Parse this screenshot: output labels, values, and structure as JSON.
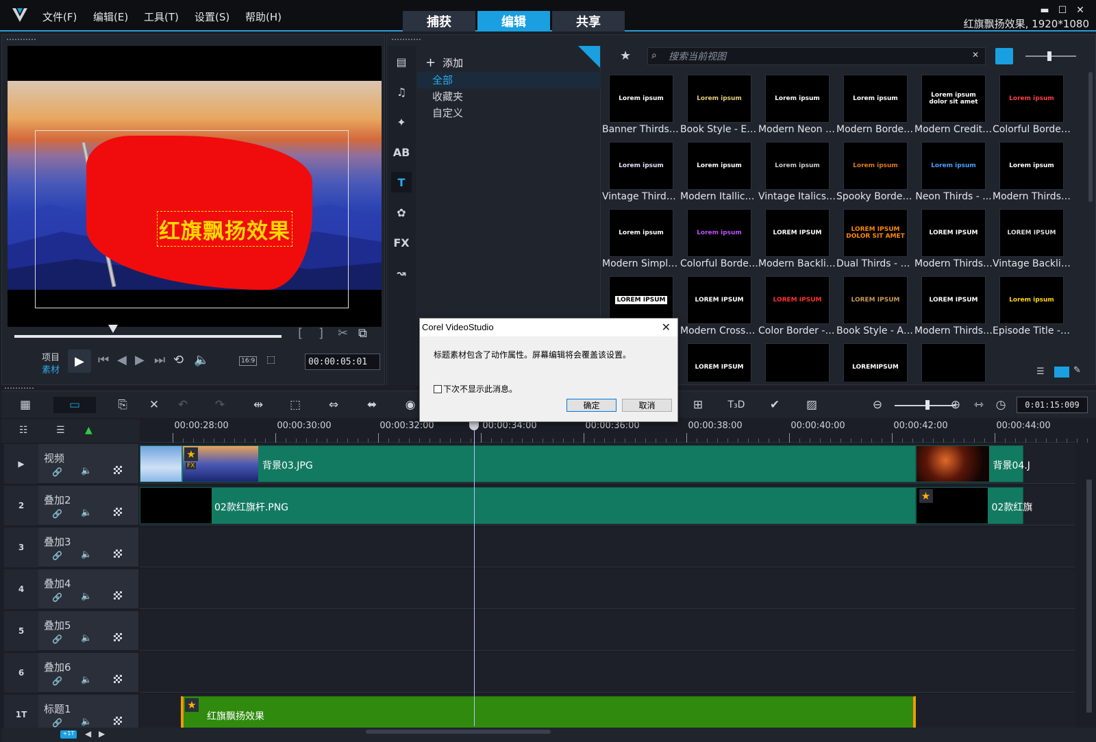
{
  "titlebar": {
    "menus": [
      "文件(F)",
      "编辑(E)",
      "工具(T)",
      "设置(S)",
      "帮助(H)"
    ],
    "mode_tabs": [
      "捕获",
      "编辑",
      "共享"
    ],
    "active_tab": "编辑",
    "project_title": "红旗飘扬效果, 1920*1080",
    "window_buttons": [
      "minimize-icon",
      "maximize-icon",
      "close-icon"
    ]
  },
  "player": {
    "overlay_text": "红旗飘扬效果",
    "mode_project": "项目",
    "mode_clip": "素材",
    "aspect": "16:9",
    "timecode": "00:00:05:01",
    "scrub_progress": 0.37
  },
  "library": {
    "add_label": "添加",
    "folders": [
      "全部",
      "收藏夹",
      "自定义"
    ],
    "active_folder": "全部",
    "search_placeholder": "搜索当前视图",
    "sidebar_icons": [
      "media-icon",
      "music-icon",
      "instant-project-icon",
      "transition-icon",
      "title-icon",
      "graphics-icon",
      "filter-icon",
      "path-icon"
    ],
    "sidebar_labels": {
      "transition": "AB",
      "title": "T",
      "filter": "FX"
    },
    "tiles": [
      {
        "label": "Banner Thirds - ...",
        "preview": "Lorem ipsum",
        "color": "#ffffff"
      },
      {
        "label": "Book Style - Ex...",
        "preview": "Lorem ipsum",
        "color": "#e8d07a"
      },
      {
        "label": "Modern Neon -...",
        "preview": "Lorem ipsum",
        "color": "#ffffff"
      },
      {
        "label": "Modern Border...",
        "preview": "Lorem ipsum",
        "color": "#ffffff"
      },
      {
        "label": "Modern Credits...",
        "preview": "Lorem ipsum dolor sit amet",
        "color": "#ffffff"
      },
      {
        "label": "Colorful Border...",
        "preview": "Lorem ipsum",
        "color": "#ff4040"
      },
      {
        "label": "Vintage Thirds ...",
        "preview": "Lorem ipsum",
        "color": "#e8e0ff"
      },
      {
        "label": "Modern Itallics ...",
        "preview": "Lorem ipsum",
        "color": "#ffffff"
      },
      {
        "label": "Vintage Italics -...",
        "preview": "Lorem ipsum",
        "color": "#cccccc"
      },
      {
        "label": "Spooky Border ...",
        "preview": "Lorem ipsum",
        "color": "#e07a1a"
      },
      {
        "label": "Neon Thirds - ...",
        "preview": "Lorem ipsum",
        "color": "#4aa0ff"
      },
      {
        "label": "Modern Thirds ...",
        "preview": "Lorem ipsum",
        "color": "#ffffff"
      },
      {
        "label": "Modern Simple...",
        "preview": "Lorem ipsum",
        "color": "#ffffff"
      },
      {
        "label": "Colorful Border...",
        "preview": "Lorem ipsum",
        "color": "#c050ff"
      },
      {
        "label": "Modern Backlig...",
        "preview": "LOREM IPSUM",
        "color": "#ffffff"
      },
      {
        "label": "Dual Thirds - R...",
        "preview": "LOREM IPSUM DOLOR SIT AMET",
        "color": "#ff8a00"
      },
      {
        "label": "Modern Thirds ...",
        "preview": "LOREM IPSUM",
        "color": "#ffffff"
      },
      {
        "label": "Vintage Backlig...",
        "preview": "LOREM IPSUM",
        "color": "#dddddd"
      },
      {
        "label": "",
        "preview": "LOREM IPSUM",
        "color": "#000000"
      },
      {
        "label": "Modern Crossw...",
        "preview": "LOREM IPSUM",
        "color": "#ffffff"
      },
      {
        "label": "Color Border - ...",
        "preview": "LOREM IPSUM",
        "color": "#ff3030"
      },
      {
        "label": "Book Style - Ap...",
        "preview": "LOREM IPSUM",
        "color": "#c89a5a"
      },
      {
        "label": "Modern Thirds ...",
        "preview": "LOREM IPSUM",
        "color": "#ffffff"
      },
      {
        "label": "Episode Title - ...",
        "preview": "Lorem ipsum",
        "color": "#ffd800"
      },
      {
        "label": "",
        "preview": "",
        "color": "#ffffff"
      },
      {
        "label": "",
        "preview": "LOREM IPSUM",
        "color": "#ffffff"
      },
      {
        "label": "",
        "preview": "",
        "color": "#ffffff"
      },
      {
        "label": "",
        "preview": "LOREMIPSUM",
        "color": "#ffffff"
      },
      {
        "label": "",
        "preview": "",
        "color": "#ffffff"
      }
    ]
  },
  "dialog": {
    "title": "Corel VideoStudio",
    "message": "标题素材包含了动作属性。屏幕编辑将会覆盖该设置。",
    "checkbox_label": "下次不显示此消息。",
    "checkbox_checked": false,
    "ok_label": "确定",
    "cancel_label": "取消"
  },
  "timeline": {
    "timecode": "0:01:15:009",
    "zoom_level": 0.55,
    "ruler": [
      "00:00:28:00",
      "00:00:30:00",
      "00:00:32:00",
      "00:00:34:00",
      "00:00:36:00",
      "00:00:38:00",
      "00:00:40:00",
      "00:00:42:00",
      "00:00:44:00"
    ],
    "playhead_time": "00:00:33:27",
    "tracks": [
      {
        "id": "video",
        "badge": "▶",
        "name": "视频",
        "clips": [
          {
            "label": "背景03.JPG",
            "start_sec": 27.7,
            "end_sec": 42.8,
            "has_star": true,
            "has_fx": true
          },
          {
            "label": "背景04.J",
            "start_sec": 42.8,
            "end_sec": 44.9,
            "has_star": false
          }
        ]
      },
      {
        "id": "overlay2",
        "badge": "2",
        "name": "叠加2",
        "clips": [
          {
            "label": "02款红旗杆.PNG",
            "start_sec": 27.7,
            "end_sec": 42.8,
            "has_star": false
          },
          {
            "label": "02款红旗",
            "start_sec": 42.8,
            "end_sec": 44.9,
            "has_star": true
          }
        ]
      },
      {
        "id": "overlay3",
        "badge": "3",
        "name": "叠加3",
        "clips": []
      },
      {
        "id": "overlay4",
        "badge": "4",
        "name": "叠加4",
        "clips": []
      },
      {
        "id": "overlay5",
        "badge": "5",
        "name": "叠加5",
        "clips": []
      },
      {
        "id": "overlay6",
        "badge": "6",
        "name": "叠加6",
        "clips": []
      },
      {
        "id": "title1",
        "badge": "1T",
        "name": "标题1",
        "clips": [
          {
            "label": "红旗飘扬效果",
            "start_sec": 28.5,
            "end_sec": 42.8,
            "has_star": true
          }
        ]
      }
    ]
  },
  "colors": {
    "accent": "#1aa0e0",
    "clip_green": "#137a62",
    "title_green": "#2f8a0e",
    "title_text": "#ffd800"
  }
}
